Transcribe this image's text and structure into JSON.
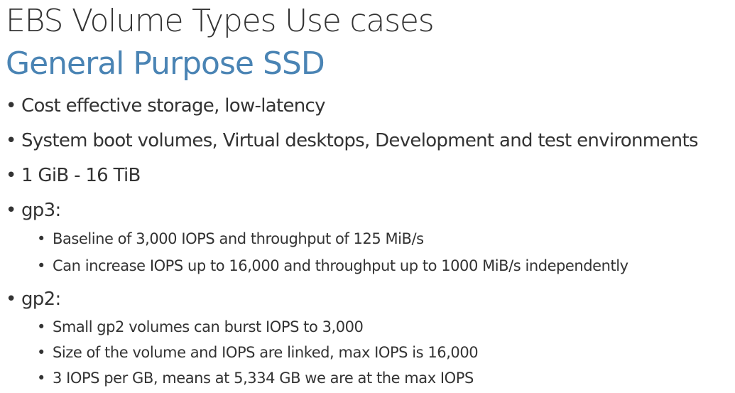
{
  "slide": {
    "title": "EBS Volume Types Use cases",
    "subtitle": "General Purpose SSD",
    "bullets": [
      {
        "text": "Cost effective storage, low-latency"
      },
      {
        "text": "System boot volumes, Virtual desktops, Development and test environments"
      },
      {
        "text": "1 GiB - 16 TiB"
      },
      {
        "text": "gp3:",
        "sub": [
          "Baseline of 3,000 IOPS and throughput of 125 MiB/s",
          "Can increase IOPS up to 16,000 and throughput up to 1000 MiB/s independently"
        ]
      },
      {
        "text": "gp2:",
        "sub": [
          "Small gp2 volumes can burst IOPS to 3,000",
          "Size of the volume and IOPS are linked, max IOPS is 16,000",
          "3 IOPS per GB, means at 5,334 GB we are at the max IOPS"
        ]
      }
    ],
    "bullet_symbol": "•",
    "colors": {
      "title": "#333333",
      "subtitle": "#4a84b4",
      "text": "#333333",
      "background": "#ffffff"
    }
  }
}
